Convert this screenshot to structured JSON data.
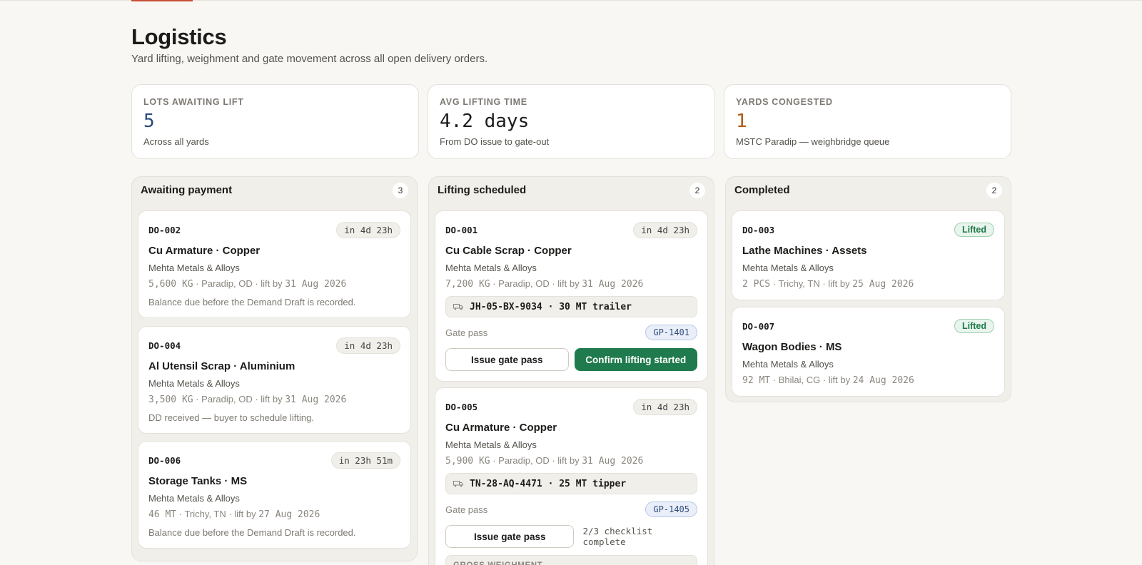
{
  "page": {
    "title": "Logistics",
    "subtitle": "Yard lifting, weighment and gate movement across all open delivery orders."
  },
  "stats": [
    {
      "label": "LOTS AWAITING LIFT",
      "value": "5",
      "sub": "Across all yards",
      "color": "#2c4a7e"
    },
    {
      "label": "AVG LIFTING TIME",
      "value": "4.2 days",
      "sub": "From DO issue to gate-out",
      "color": "#1c1b19"
    },
    {
      "label": "YARDS CONGESTED",
      "value": "1",
      "sub": "MSTC Paradip — weighbridge queue",
      "color": "#b45a12"
    }
  ],
  "columns": {
    "awaiting": {
      "title": "Awaiting payment",
      "count": "3",
      "cards": [
        {
          "id": "DO-002",
          "timer": "in 4d 23h",
          "title": "Cu Armature · Copper",
          "party": "Mehta Metals & Alloys",
          "qty": "5,600 KG",
          "place": " · Paradip, OD · lift by ",
          "date": "31 Aug 2026",
          "note": "Balance due before the Demand Draft is recorded."
        },
        {
          "id": "DO-004",
          "timer": "in 4d 23h",
          "title": "Al Utensil Scrap · Aluminium",
          "party": "Mehta Metals & Alloys",
          "qty": "3,500 KG",
          "place": " · Paradip, OD · lift by ",
          "date": "31 Aug 2026",
          "note": "DD received — buyer to schedule lifting."
        },
        {
          "id": "DO-006",
          "timer": "in 23h 51m",
          "title": "Storage Tanks · MS",
          "party": "Mehta Metals & Alloys",
          "qty": "46 MT",
          "place": " · Trichy, TN · lift by ",
          "date": "27 Aug 2026",
          "note": "Balance due before the Demand Draft is recorded."
        }
      ]
    },
    "scheduled": {
      "title": "Lifting scheduled",
      "count": "2",
      "cards": [
        {
          "id": "DO-001",
          "timer": "in 4d 23h",
          "title": "Cu Cable Scrap · Copper",
          "party": "Mehta Metals & Alloys",
          "qty": "7,200 KG",
          "place": " · Paradip, OD · lift by ",
          "date": "31 Aug 2026",
          "vehicle": "JH-05-BX-9034 · 30 MT trailer",
          "gate_label": "Gate pass",
          "gate_pass": "GP-1401",
          "btn_issue": "Issue gate pass",
          "btn_confirm": "Confirm lifting started"
        },
        {
          "id": "DO-005",
          "timer": "in 4d 23h",
          "title": "Cu Armature · Copper",
          "party": "Mehta Metals & Alloys",
          "qty": "5,900 KG",
          "place": " · Paradip, OD · lift by ",
          "date": "31 Aug 2026",
          "vehicle": "TN-28-AQ-4471 · 25 MT tipper",
          "gate_label": "Gate pass",
          "gate_pass": "GP-1405",
          "btn_issue": "Issue gate pass",
          "checklist": "2/3 checklist complete",
          "weighment": "GROSS WEIGHMENT"
        }
      ]
    },
    "completed": {
      "title": "Completed",
      "count": "2",
      "cards": [
        {
          "id": "DO-003",
          "status": "Lifted",
          "title": "Lathe Machines · Assets",
          "party": "Mehta Metals & Alloys",
          "qty": "2 PCS",
          "place": " · Trichy, TN · lift by ",
          "date": "25 Aug 2026"
        },
        {
          "id": "DO-007",
          "status": "Lifted",
          "title": "Wagon Bodies · MS",
          "party": "Mehta Metals & Alloys",
          "qty": "92 MT",
          "place": " · Bhilai, CG · lift by ",
          "date": "24 Aug 2026"
        }
      ]
    }
  }
}
